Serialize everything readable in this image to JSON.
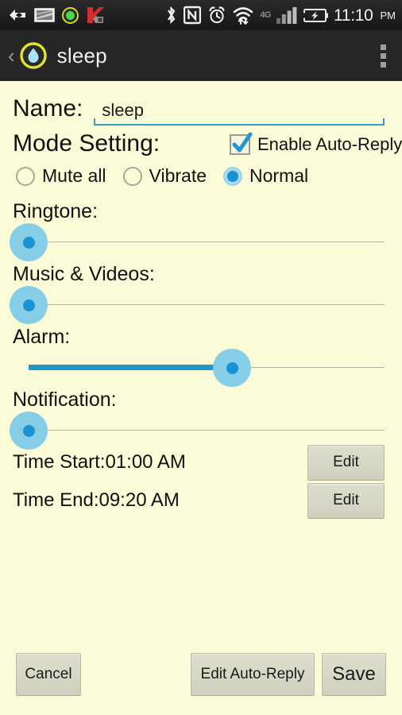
{
  "status_bar": {
    "icons": [
      "back-arrow-plus-icon",
      "screenshot-icon",
      "green-circle-app-icon",
      "kaspersky-icon",
      "bluetooth-icon",
      "nfc-icon",
      "alarm-clock-icon",
      "wifi-transfer-icon",
      "signal-bars-icon",
      "battery-charging-icon"
    ],
    "network_label": "4G",
    "time": "11:10",
    "ampm": "PM",
    "colors": {
      "background": "#212121",
      "text": "#f2f2f2",
      "dim": "#8a8a8a"
    }
  },
  "action_bar": {
    "back_label": "‹",
    "app_icon": "sleep-droplet-icon",
    "title": "sleep",
    "overflow_label": "overflow-menu-icon",
    "colors": {
      "background": "#262626",
      "title": "#f0f0f0"
    }
  },
  "form": {
    "name": {
      "label": "Name:",
      "value": "sleep",
      "placeholder": "Name"
    },
    "mode_setting": {
      "label": "Mode Setting:",
      "auto_reply": {
        "label": "Enable Auto-Reply",
        "checked": "true"
      },
      "options": [
        {
          "label": "Mute all",
          "selected": "false"
        },
        {
          "label": "Vibrate",
          "selected": "false"
        },
        {
          "label": "Normal",
          "selected": "true"
        }
      ]
    },
    "sliders": [
      {
        "label": "Ringtone:",
        "value": 0,
        "percent": 0
      },
      {
        "label": "Music & Videos:",
        "value": 0,
        "percent": 0
      },
      {
        "label": "Alarm:",
        "value": 57,
        "percent": 57
      },
      {
        "label": "Notification:",
        "value": 0,
        "percent": 0
      }
    ],
    "times": [
      {
        "label": "Time Start:01:00 AM",
        "button": "Edit"
      },
      {
        "label": "Time End:09:20 AM",
        "button": "Edit"
      }
    ]
  },
  "footer": {
    "cancel_label": "Cancel",
    "edit_auto_reply_label": "Edit Auto-Reply",
    "save_label": "Save"
  },
  "theme": {
    "page_background": "#FBFBD8",
    "accent_blue": "#1b92d1",
    "slider_halo": "#86cde8",
    "underline_blue": "#3a9dc4",
    "button_face": "#D7D7C6"
  }
}
